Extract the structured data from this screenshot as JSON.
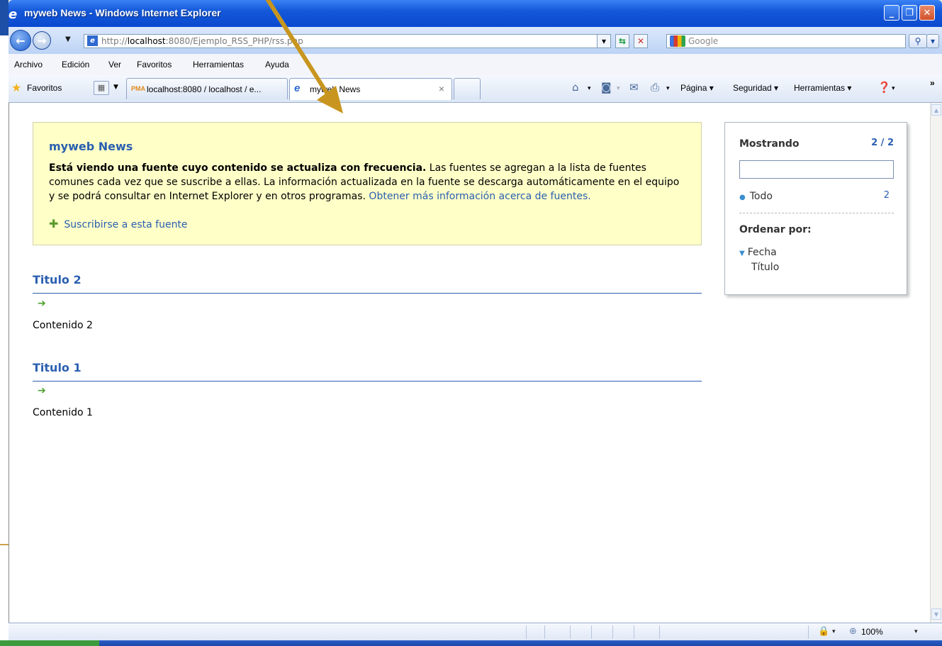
{
  "window": {
    "title": "myweb News - Windows Internet Explorer",
    "minimize": "_",
    "restore": "❐",
    "close": "✕"
  },
  "address_bar": {
    "url_prefix": "http://",
    "url_host": "localhost",
    "url_rest": ":8080/Ejemplo_RSS_PHP/rss.php",
    "search_placeholder": "Google"
  },
  "menu": [
    "Archivo",
    "Edición",
    "Ver",
    "Favoritos",
    "Herramientas",
    "Ayuda"
  ],
  "favorites": {
    "label": "Favoritos"
  },
  "tabs": [
    {
      "label": "localhost:8080 / localhost / e...",
      "icon": "PMA"
    },
    {
      "label": "myweb News",
      "icon": "e"
    }
  ],
  "command_bar": {
    "page": "Página ▾",
    "security": "Seguridad ▾",
    "tools": "Herramientas ▾",
    "more": "»"
  },
  "feed": {
    "title": "myweb News",
    "desc_bold": "Está viendo una fuente cuyo contenido se actualiza con frecuencia.",
    "desc_text": " Las fuentes se agregan a la lista de fuentes comunes cada vez que se suscribe a ellas. La información actualizada en la fuente se descarga automáticamente en el equipo y se podrá consultar en Internet Explorer y en otros programas. ",
    "desc_link": "Obtener más información acerca de fuentes.",
    "subscribe": "Suscribirse a esta fuente"
  },
  "articles": [
    {
      "title": "Titulo 2",
      "body": "Contenido 2"
    },
    {
      "title": "Titulo 1",
      "body": "Contenido 1"
    }
  ],
  "side_panel": {
    "showing_label": "Mostrando",
    "showing_count": "2 / 2",
    "filter_value": "",
    "all_label": "Todo",
    "all_count": "2",
    "sort_label": "Ordenar por:",
    "sort_options": [
      "Fecha",
      "Título"
    ]
  },
  "status_bar": {
    "zoom": "100%"
  },
  "colors": {
    "link": "#2a5fb0",
    "infobox_bg": "#ffffc8",
    "arrow_annotation": "#c8961e"
  }
}
